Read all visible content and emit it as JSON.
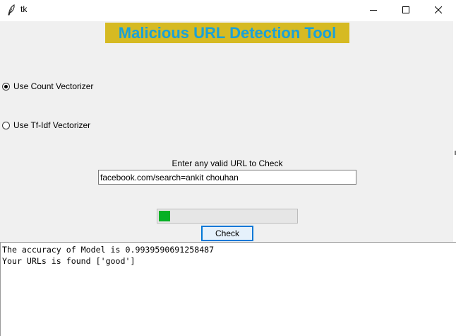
{
  "window": {
    "title": "tk",
    "app_icon": "feather-icon",
    "controls": [
      "minimize-icon",
      "maximize-icon",
      "close-icon"
    ]
  },
  "heading": {
    "text": "Malicious URL Detection Tool",
    "background": "#d6ba22",
    "color": "#1aa1d8"
  },
  "options": {
    "count_vectorizer": {
      "label": "Use Count Vectorizer",
      "selected": true
    },
    "tfidf_vectorizer": {
      "label": "Use Tf-Idf Vectorizer",
      "selected": false
    }
  },
  "url_entry": {
    "label": "Enter any valid URL to Check",
    "value": "facebook.com/search=ankit chouhan"
  },
  "progress": {
    "fraction": 0.04,
    "color": "#06b025"
  },
  "check_button": {
    "label": "Check"
  },
  "output": {
    "lines": [
      "The accuracy of Model is 0.9939590691258487",
      "Your URLs is found ['good']"
    ]
  }
}
